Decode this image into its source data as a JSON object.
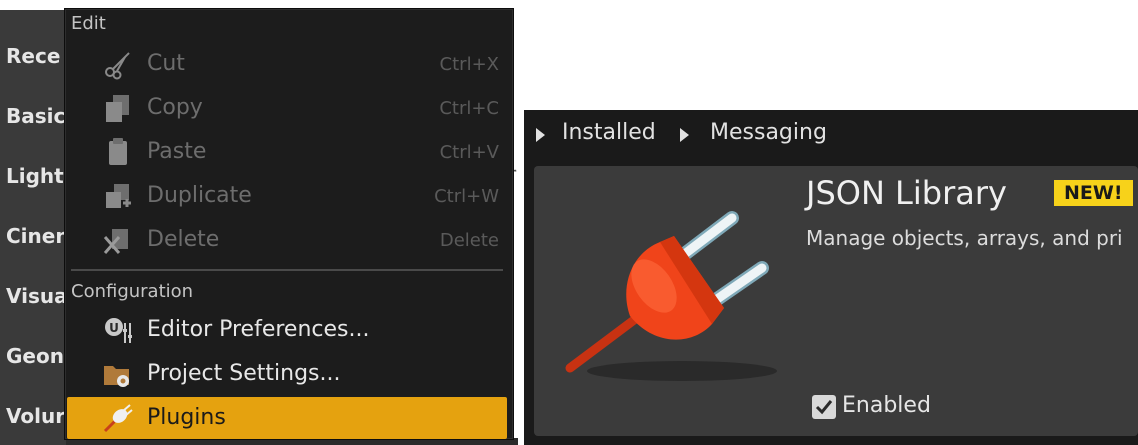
{
  "sidebar": {
    "items": [
      {
        "label": "Rece"
      },
      {
        "label": "Basic"
      },
      {
        "label": "Light"
      },
      {
        "label": "Cinen"
      },
      {
        "label": "Visua"
      },
      {
        "label": "Geon"
      },
      {
        "label": "Volur"
      }
    ]
  },
  "edit_menu": {
    "sections": [
      {
        "header": "Edit"
      },
      {
        "header": "Configuration"
      }
    ],
    "items": [
      {
        "label": "Cut",
        "shortcut": "Ctrl+X",
        "icon": "scissors-icon"
      },
      {
        "label": "Copy",
        "shortcut": "Ctrl+C",
        "icon": "copy-icon"
      },
      {
        "label": "Paste",
        "shortcut": "Ctrl+V",
        "icon": "clipboard-icon"
      },
      {
        "label": "Duplicate",
        "shortcut": "Ctrl+W",
        "icon": "duplicate-icon"
      },
      {
        "label": "Delete",
        "shortcut": "Delete",
        "icon": "delete-icon"
      },
      {
        "label": "Editor Preferences...",
        "icon": "editor-preferences-icon"
      },
      {
        "label": "Project Settings...",
        "icon": "project-settings-icon"
      },
      {
        "label": "Plugins",
        "icon": "plug-icon"
      }
    ],
    "stray_text": "r"
  },
  "plugins_panel": {
    "breadcrumb": [
      "Installed",
      "Messaging"
    ],
    "plugin": {
      "name": "JSON Library",
      "badge": "NEW!",
      "description": "Manage objects, arrays, and pri",
      "enabled_label": "Enabled",
      "enabled": true
    }
  },
  "colors": {
    "menu_bg": "#1c1c1c",
    "highlight": "#e5a20f",
    "badge": "#f7d21a",
    "card_bg": "#3b3b3b",
    "plug_orange": "#f0441a"
  }
}
